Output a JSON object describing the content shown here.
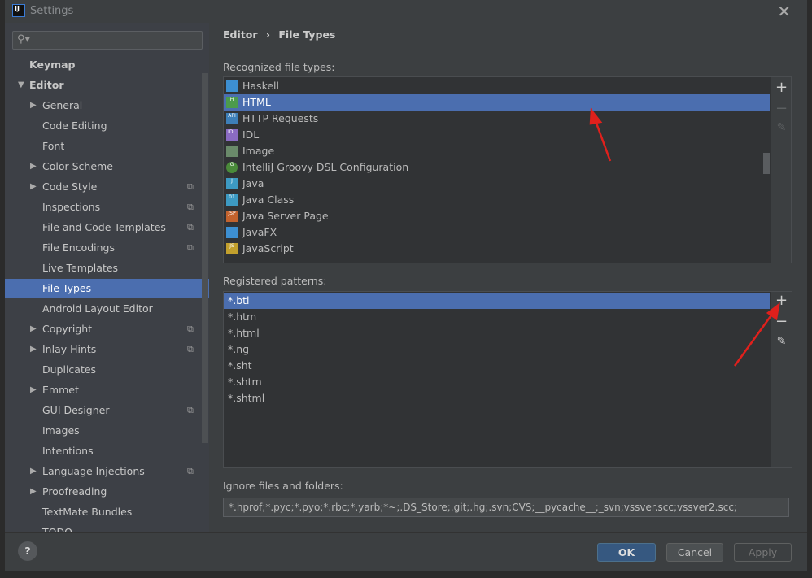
{
  "window": {
    "title": "Settings",
    "close_icon": "close-icon"
  },
  "search": {
    "placeholder": ""
  },
  "sidebar": {
    "items": [
      {
        "label": "Keymap",
        "level": 0,
        "bold": true
      },
      {
        "label": "Editor",
        "level": 0,
        "bold": true,
        "expanded": true
      },
      {
        "label": "General",
        "level": 1,
        "arrow": true
      },
      {
        "label": "Code Editing",
        "level": 1
      },
      {
        "label": "Font",
        "level": 1
      },
      {
        "label": "Color Scheme",
        "level": 1,
        "arrow": true
      },
      {
        "label": "Code Style",
        "level": 1,
        "arrow": true,
        "copy": true
      },
      {
        "label": "Inspections",
        "level": 1,
        "copy": true
      },
      {
        "label": "File and Code Templates",
        "level": 1,
        "copy": true
      },
      {
        "label": "File Encodings",
        "level": 1,
        "copy": true
      },
      {
        "label": "Live Templates",
        "level": 1
      },
      {
        "label": "File Types",
        "level": 1,
        "selected": true
      },
      {
        "label": "Android Layout Editor",
        "level": 1
      },
      {
        "label": "Copyright",
        "level": 1,
        "arrow": true,
        "copy": true
      },
      {
        "label": "Inlay Hints",
        "level": 1,
        "arrow": true,
        "copy": true
      },
      {
        "label": "Duplicates",
        "level": 1
      },
      {
        "label": "Emmet",
        "level": 1,
        "arrow": true
      },
      {
        "label": "GUI Designer",
        "level": 1,
        "copy": true
      },
      {
        "label": "Images",
        "level": 1
      },
      {
        "label": "Intentions",
        "level": 1
      },
      {
        "label": "Language Injections",
        "level": 1,
        "arrow": true,
        "copy": true
      },
      {
        "label": "Proofreading",
        "level": 1,
        "arrow": true
      },
      {
        "label": "TextMate Bundles",
        "level": 1
      },
      {
        "label": "TODO",
        "level": 1
      }
    ]
  },
  "breadcrumb": {
    "parent": "Editor",
    "separator": "›",
    "current": "File Types"
  },
  "recognized": {
    "label": "Recognized file types:",
    "items": [
      {
        "label": "Haskell",
        "badge": "",
        "color": "#3d8fd1"
      },
      {
        "label": "HTML",
        "badge": "H",
        "color": "#4c9b4c",
        "selected": true
      },
      {
        "label": "HTTP Requests",
        "badge": "API",
        "color": "#3d7fb8"
      },
      {
        "label": "IDL",
        "badge": "IDL",
        "color": "#8a6bc2"
      },
      {
        "label": "Image",
        "badge": "",
        "color": "#6a8a6a"
      },
      {
        "label": "IntelliJ Groovy DSL Configuration",
        "badge": "G",
        "color": "#4a8a3a"
      },
      {
        "label": "Java",
        "badge": "J",
        "color": "#3d9ac2"
      },
      {
        "label": "Java Class",
        "badge": "01",
        "color": "#3d9ac2"
      },
      {
        "label": "Java Server Page",
        "badge": "JSP",
        "color": "#c2622d"
      },
      {
        "label": "JavaFX",
        "badge": "",
        "color": "#3d8fd1"
      },
      {
        "label": "JavaScript",
        "badge": "JS",
        "color": "#c2a02d"
      }
    ]
  },
  "patterns": {
    "label": "Registered patterns:",
    "items": [
      "*.btl",
      "*.htm",
      "*.html",
      "*.ng",
      "*.sht",
      "*.shtm",
      "*.shtml"
    ],
    "selected": 0
  },
  "ignore": {
    "label": "Ignore files and folders:",
    "value": "*.hprof;*.pyc;*.pyo;*.rbc;*.yarb;*~;.DS_Store;.git;.hg;.svn;CVS;__pycache__;_svn;vssver.scc;vssver2.scc;"
  },
  "toolbar": {
    "add": "+",
    "remove": "−",
    "edit": "✎"
  },
  "buttons": {
    "ok": "OK",
    "cancel": "Cancel",
    "apply": "Apply",
    "help": "?"
  },
  "colors": {
    "selection": "#4b6eaf",
    "annotation_arrow": "#e0201c"
  }
}
